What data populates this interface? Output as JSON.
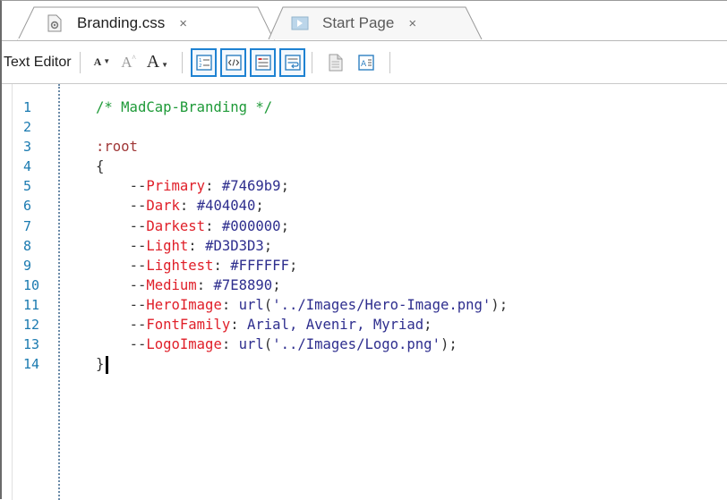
{
  "tabs": [
    {
      "label": "Branding.css",
      "close": "×",
      "active": true,
      "icon": "css-file-gear-icon"
    },
    {
      "label": "Start Page",
      "close": "×",
      "active": false,
      "icon": "start-page-icon"
    }
  ],
  "toolbar": {
    "label": "Text Editor",
    "font_buttons": [
      {
        "glyph": "A",
        "icon": "font-size-small-icon",
        "has_dropdown": true
      },
      {
        "glyph": "A",
        "icon": "increase-font-icon",
        "has_dropdown": false
      },
      {
        "glyph": "A",
        "icon": "font-size-large-icon",
        "has_dropdown": true
      }
    ],
    "view_buttons": [
      "line-numbers-icon",
      "code-view-icon",
      "highlight-icon",
      "word-wrap-icon"
    ],
    "other_buttons": [
      "document-icon",
      "text-box-icon"
    ]
  },
  "editor": {
    "line_numbers": [
      "1",
      "2",
      "3",
      "4",
      "5",
      "6",
      "7",
      "8",
      "9",
      "10",
      "11",
      "12",
      "13",
      "14"
    ],
    "comment": "/* MadCap-Branding */",
    "selector": ":root",
    "open_brace": "{",
    "close_brace": "}",
    "dashes": "--",
    "colon": ":",
    "semicolon": ";",
    "declarations": [
      {
        "property": "Primary",
        "value": "#7469b9"
      },
      {
        "property": "Dark",
        "value": "#404040"
      },
      {
        "property": "Darkest",
        "value": "#000000"
      },
      {
        "property": "Light",
        "value": "#D3D3D3"
      },
      {
        "property": "Lightest",
        "value": "#FFFFFF"
      },
      {
        "property": "Medium",
        "value": "#7E8890"
      },
      {
        "property": "HeroImage",
        "value_fn": "url",
        "value_arg": "'../Images/Hero-Image.png'"
      },
      {
        "property": "FontFamily",
        "value": "Arial, Avenir, Myriad"
      },
      {
        "property": "LogoImage",
        "value_fn": "url",
        "value_arg": "'../Images/Logo.png'"
      }
    ]
  },
  "colors": {
    "comment": "#1e9a38",
    "selector": "#a03838",
    "property": "#e0202a",
    "value": "#2e2e8e",
    "line_number": "#1a7ab0",
    "selected_button_border": "#1e82d2"
  }
}
